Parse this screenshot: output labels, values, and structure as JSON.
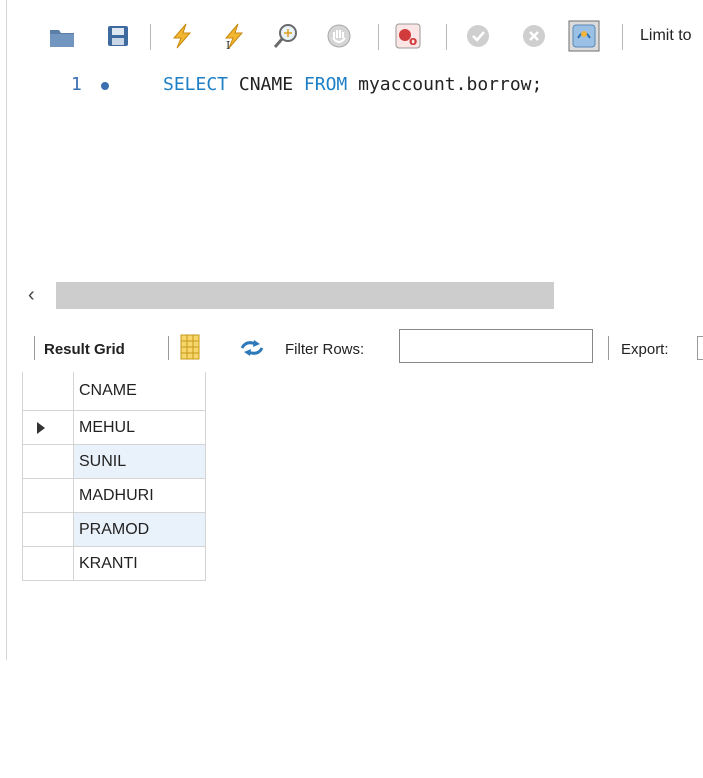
{
  "toolbar": {
    "limit_label": "Limit to",
    "icons": [
      "open-folder-icon",
      "save-icon",
      "execute-icon",
      "execute-current-icon",
      "explain-icon",
      "stop-icon",
      "toggle-errors-icon",
      "commit-icon",
      "rollback-icon",
      "autocommit-icon"
    ]
  },
  "editor": {
    "line_number": "1",
    "kw_select": "SELECT",
    "col": "CNAME",
    "kw_from": "FROM",
    "table": "myaccount.borrow;"
  },
  "results_toolbar": {
    "result_grid_label": "Result Grid",
    "filter_label": "Filter Rows:",
    "filter_value": "",
    "export_label": "Export:"
  },
  "result_grid": {
    "columns": [
      "CNAME"
    ],
    "rows": [
      [
        "MEHUL"
      ],
      [
        "SUNIL"
      ],
      [
        "MADHURI"
      ],
      [
        "PRAMOD"
      ],
      [
        "KRANTI"
      ]
    ]
  }
}
